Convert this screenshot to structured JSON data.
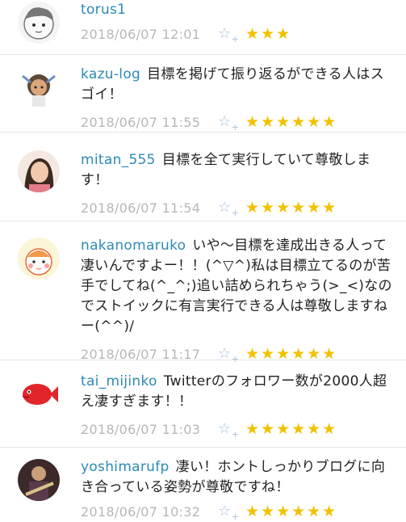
{
  "comments": [
    {
      "user": "torus1",
      "text": "",
      "time": "2018/06/07 12:01",
      "stars": "★★★"
    },
    {
      "user": "kazu-log",
      "text": "目標を掲げて振り返るができる人はスゴイ！",
      "time": "2018/06/07 11:55",
      "stars": "★★★★★★"
    },
    {
      "user": "mitan_555",
      "text": "目標を全て実行していて尊敬します！",
      "time": "2018/06/07 11:54",
      "stars": "★★★★★★"
    },
    {
      "user": "nakanomaruko",
      "text": "いや〜目標を達成出きる人って凄いんですよー！！(^▽^)私は目標立てるのが苦手でしてね(^_^;)追い詰められちゃう(>_<)なのでストイックに有言実行できる人は尊敬しますねー(^^)/",
      "time": "2018/06/07 11:17",
      "stars": "★★★★★★"
    },
    {
      "user": "tai_mijinko",
      "text": "Twitterのフォロワー数が2000人超え凄すぎます！！",
      "time": "2018/06/07 11:03",
      "stars": "★★★★★★"
    },
    {
      "user": "yoshimarufp",
      "text": "凄い！ホントしっかりブログに向き合っている姿勢が尊敬ですね！",
      "time": "2018/06/07 10:32",
      "stars": "★★★★★★"
    }
  ],
  "icons": {
    "add_star": "☆",
    "add_star_plus": "+"
  },
  "colors": {
    "username": "#2b8bb5",
    "star": "#f1c200",
    "timestamp": "#b7b7b7",
    "add_star": "#a9c1dc"
  }
}
